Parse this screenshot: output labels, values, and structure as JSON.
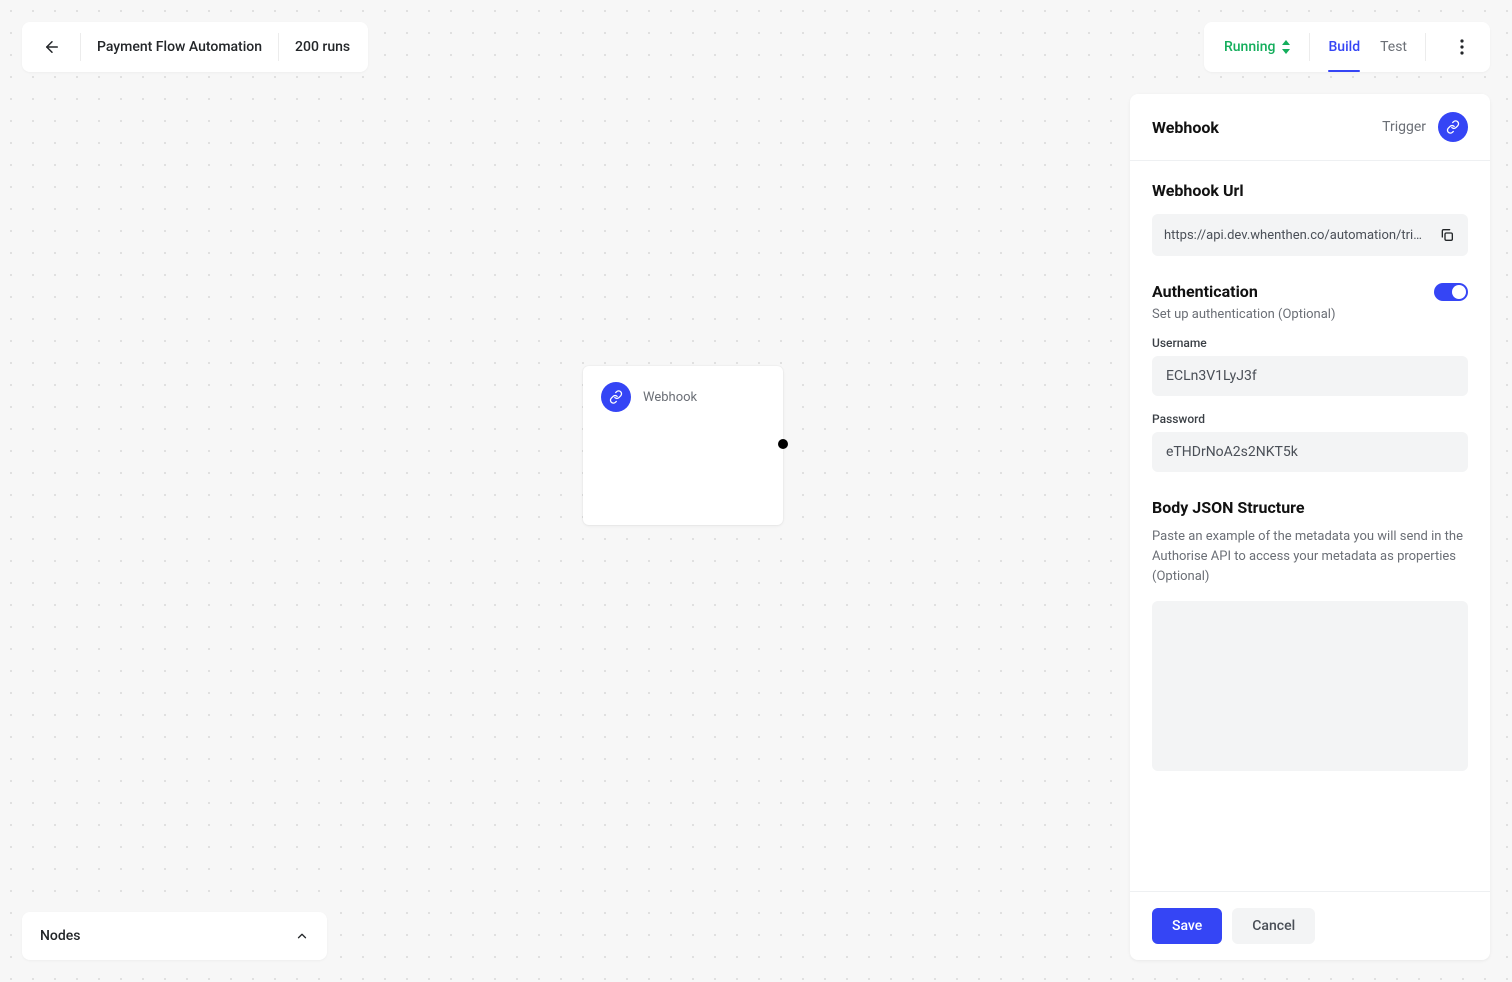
{
  "colors": {
    "accent": "#3545f5",
    "success": "#14ae5c"
  },
  "header": {
    "title": "Payment Flow Automation",
    "runs": "200 runs"
  },
  "toolbar": {
    "status": "Running",
    "tabs": {
      "build": "Build",
      "test": "Test"
    }
  },
  "canvas": {
    "node": {
      "label": "Webhook",
      "icon": "link-icon"
    }
  },
  "nodes_panel": {
    "label": "Nodes"
  },
  "side_panel": {
    "title": "Webhook",
    "subtype": "Trigger",
    "webhook_url": {
      "label": "Webhook Url",
      "value": "https://api.dev.whenthen.co/automation/trig…"
    },
    "authentication": {
      "label": "Authentication",
      "sub": "Set up authentication (Optional)",
      "enabled": true,
      "username": {
        "label": "Username",
        "value": "ECLn3V1LyJ3f"
      },
      "password": {
        "label": "Password",
        "value": "eTHDrNoA2s2NKT5k"
      }
    },
    "body_json": {
      "label": "Body JSON Structure",
      "desc": "Paste an example of the metadata you will send in the Authorise API to access your metadata as properties (Optional)",
      "value": ""
    },
    "buttons": {
      "save": "Save",
      "cancel": "Cancel"
    }
  }
}
